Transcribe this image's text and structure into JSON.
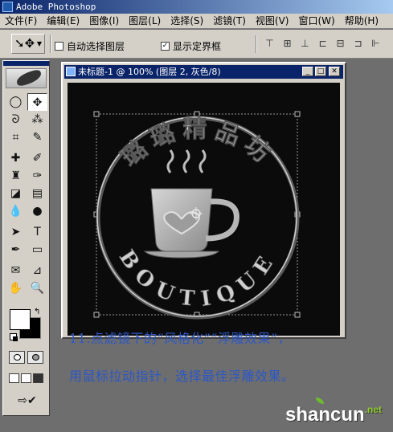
{
  "app": {
    "title": "Adobe Photoshop"
  },
  "menu": [
    "文件(F)",
    "编辑(E)",
    "图像(I)",
    "图层(L)",
    "选择(S)",
    "滤镜(T)",
    "视图(V)",
    "窗口(W)",
    "帮助(H)"
  ],
  "options": {
    "auto_select_layer": "自动选择图层",
    "show_bounding_box": "显示定界框",
    "auto_select_checked": false,
    "show_bounding_checked": true
  },
  "document": {
    "title": "未标题-1 @ 100% (图层 2, 灰色/8)"
  },
  "artwork": {
    "top_text": "璐璐精品坊",
    "bottom_text": "BOUTIQUE"
  },
  "caption": {
    "line1": "11.点滤镜下的“风格化”“浮雕效果”，",
    "line2": "用鼠标拉动指针，选择最佳浮雕效果。"
  },
  "watermark": {
    "brand": "shancun",
    "tld": ".net"
  }
}
